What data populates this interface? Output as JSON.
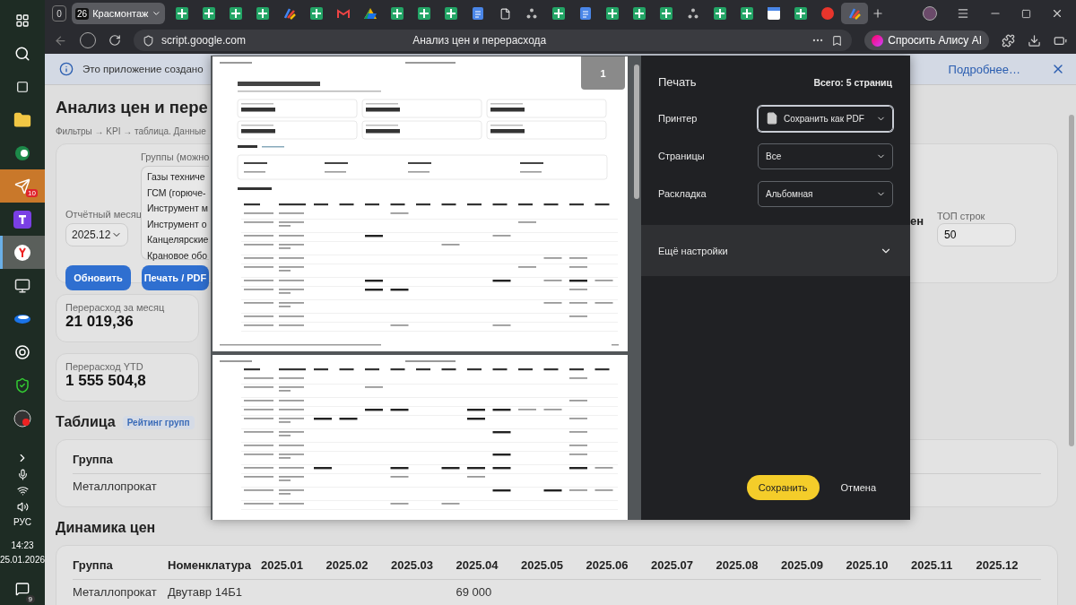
{
  "taskbar": {
    "apps": [
      {
        "kind": "windows",
        "attention": false,
        "active": false
      },
      {
        "kind": "search",
        "attention": false,
        "active": false
      },
      {
        "kind": "taskview",
        "attention": false,
        "active": false
      },
      {
        "kind": "folder",
        "attention": false,
        "active": false
      },
      {
        "kind": "green-app",
        "attention": false,
        "active": false
      },
      {
        "kind": "telegram",
        "attention": true,
        "active": false,
        "badge": "10"
      },
      {
        "kind": "purple-app",
        "attention": false,
        "active": false
      },
      {
        "kind": "yandex",
        "attention": false,
        "active": true
      },
      {
        "kind": "computer",
        "attention": false,
        "active": false
      },
      {
        "kind": "blue-app",
        "attention": false,
        "active": false
      },
      {
        "kind": "chatgpt",
        "attention": false,
        "active": false
      },
      {
        "kind": "shield",
        "attention": false,
        "active": false
      },
      {
        "kind": "recorder",
        "attention": false,
        "active": false
      }
    ],
    "language": "РУС",
    "time": "14:23",
    "date": "25.01.2026",
    "notifications": "9"
  },
  "browser": {
    "tab_counter": "0",
    "group_tab": {
      "count": "26",
      "title": "Красмонтаж"
    },
    "tabs": [
      {
        "kind": "sheet",
        "selected": false
      },
      {
        "kind": "sheet",
        "selected": false
      },
      {
        "kind": "sheet",
        "selected": false
      },
      {
        "kind": "sheet",
        "selected": false
      },
      {
        "kind": "script",
        "selected": false
      },
      {
        "kind": "sheet",
        "selected": false
      },
      {
        "kind": "gmail",
        "selected": false
      },
      {
        "kind": "drive",
        "selected": false
      },
      {
        "kind": "sheet",
        "selected": false
      },
      {
        "kind": "sheet",
        "selected": false
      },
      {
        "kind": "sheet",
        "selected": false
      },
      {
        "kind": "docs",
        "selected": false
      },
      {
        "kind": "file",
        "selected": false
      },
      {
        "kind": "tree",
        "selected": false
      },
      {
        "kind": "sheet",
        "selected": false
      },
      {
        "kind": "docs",
        "selected": false
      },
      {
        "kind": "sheet",
        "selected": false
      },
      {
        "kind": "sheet",
        "selected": false
      },
      {
        "kind": "sheet",
        "selected": false
      },
      {
        "kind": "tree",
        "selected": false
      },
      {
        "kind": "sheet",
        "selected": false
      },
      {
        "kind": "sheet",
        "selected": false
      },
      {
        "kind": "calendar",
        "selected": false
      },
      {
        "kind": "sheet",
        "selected": false
      },
      {
        "kind": "yandex",
        "selected": false
      },
      {
        "kind": "script",
        "selected": true
      }
    ],
    "address": "script.google.com",
    "page_title": "Анализ цен и перерасхода",
    "alice_button": "Спросить Алису AI"
  },
  "page": {
    "info_bar": {
      "text": "Это приложение создано",
      "link": "Подробнее…"
    },
    "title": "Анализ цен и пере",
    "subtitle": "Фильтры → KPI → таблица. Данные",
    "filters": {
      "groups_label": "Группы (можно",
      "groups": [
        "Газы техниче",
        "ГСМ (горюче-",
        "Инструмент м",
        "Инструмент о",
        "Канцелярские",
        "Крановое обо"
      ],
      "month_label": "Отчётный месяц",
      "month": "2025.12",
      "refresh_button": "Обновить",
      "print_button": "Печать / PDF",
      "partial_label": "ен",
      "top_label": "ТОП строк",
      "top_value": "50"
    },
    "kpis": [
      {
        "label": "Перерасход за месяц",
        "value": "21 019,36"
      },
      {
        "label": "Перерасход YTD",
        "value": "1 555 504,8"
      }
    ],
    "table": {
      "title": "Таблица",
      "chip": "Рейтинг групп",
      "columns": [
        "Группа"
      ],
      "rows": [
        [
          "Металлопрокат"
        ]
      ]
    },
    "dynamics": {
      "title": "Динамика цен",
      "columns": [
        "Группа",
        "Номенклатура",
        "2025.01",
        "2025.02",
        "2025.03",
        "2025.04",
        "2025.05",
        "2025.06",
        "2025.07",
        "2025.08",
        "2025.09",
        "2025.10",
        "2025.11",
        "2025.12"
      ],
      "rows": [
        [
          "Металлопрокат",
          "Двутавр 14Б1",
          null,
          null,
          null,
          "69 000",
          null,
          null,
          null,
          null,
          null,
          null,
          null,
          null
        ]
      ]
    }
  },
  "print_dialog": {
    "title": "Печать",
    "total": "Всего: 5 страниц",
    "settings": [
      {
        "label": "Принтер",
        "value": "Сохранить как PDF",
        "focused": true,
        "kind": "printer"
      },
      {
        "label": "Страницы",
        "value": "Все",
        "focused": false,
        "kind": "plain"
      },
      {
        "label": "Раскладка",
        "value": "Альбомная",
        "focused": false,
        "kind": "plain"
      }
    ],
    "more": "Ещё настройки",
    "save_button": "Сохранить",
    "cancel_button": "Отмена",
    "preview": {
      "page_badge": "1"
    }
  }
}
